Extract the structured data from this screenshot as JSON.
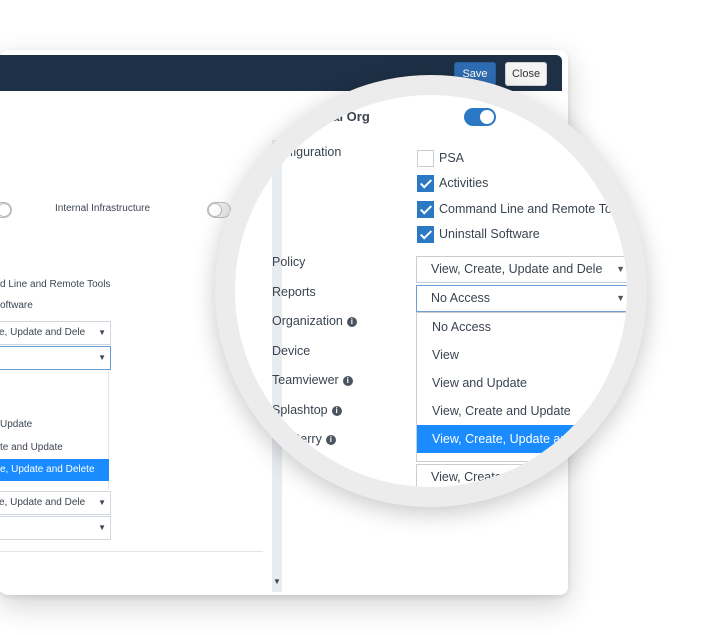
{
  "window": {
    "save_label": "Save",
    "close_label": "Close"
  },
  "background": {
    "internal_infrastructure_label": "Internal Infrastructure",
    "cmd_remote_partial": "d Line and Remote Tools",
    "software_partial": "oftware",
    "policy_select_value": "e, Update and Dele",
    "dropdown_options_partial": [
      "Update",
      "te and Update",
      "e, Update and Delete"
    ],
    "lower_select_value": "e, Update and Dele"
  },
  "magnified": {
    "internal_org_label": "ernal Org",
    "configuration_label": "onfiguration",
    "checkboxes": [
      {
        "label": "PSA",
        "checked": false
      },
      {
        "label": "Activities",
        "checked": true
      },
      {
        "label": "Command Line and Remote Tools",
        "checked": true
      },
      {
        "label": "Uninstall Software",
        "checked": true
      }
    ],
    "permissions": [
      {
        "label": "Policy",
        "info": false
      },
      {
        "label": "Reports",
        "info": false
      },
      {
        "label": "Organization",
        "info": true
      },
      {
        "label": "Device",
        "info": false
      },
      {
        "label": "Teamviewer",
        "info": true
      },
      {
        "label": "Splashtop",
        "info": true
      },
      {
        "label": "dBerry",
        "info": true
      },
      {
        "label": "ery",
        "info": false
      }
    ],
    "policy_select": "View, Create, Update and Dele",
    "reports_select": "No Access",
    "dropdown_options": [
      {
        "label": "No Access",
        "selected": false
      },
      {
        "label": "View",
        "selected": false
      },
      {
        "label": "View and Update",
        "selected": false
      },
      {
        "label": "View, Create and Update",
        "selected": false
      },
      {
        "label": "View, Create, Update and Delete",
        "selected": true
      }
    ],
    "bottom_select": "View, Create, Update"
  },
  "colors": {
    "titlebar": "#1e3046",
    "accent": "#2b78c4",
    "selected_option": "#1a8cff"
  }
}
